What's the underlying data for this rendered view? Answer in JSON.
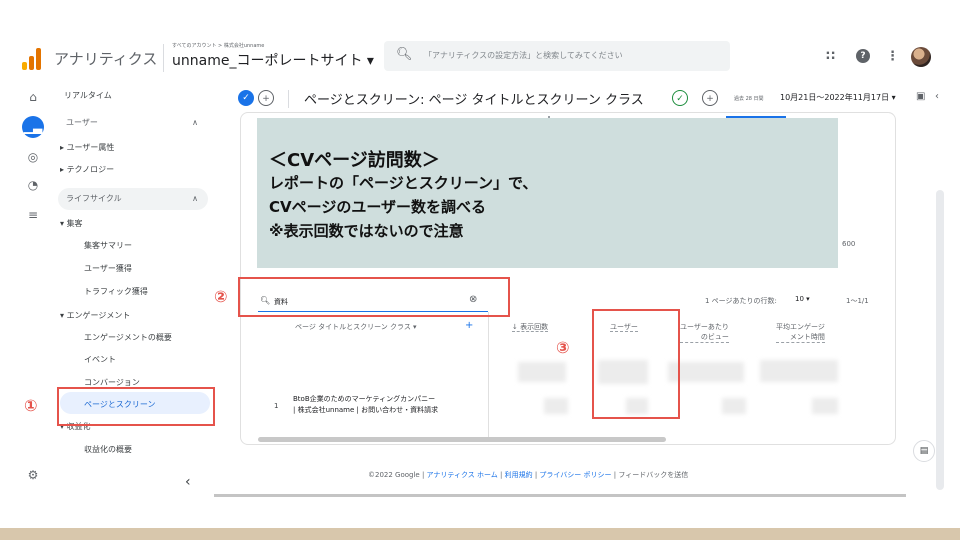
{
  "header": {
    "app_title": "アナリティクス",
    "account_path": "すべてのアカウント > 株式会社unname",
    "property_name": "unname_コーポレートサイト ▾",
    "search_placeholder": "「アナリティクスの設定方法」と検索してみてください"
  },
  "sidebar": {
    "realtime": "リアルタイム",
    "users_section": "ユーザー",
    "user_attributes": "ユーザー属性",
    "technology": "テクノロジー",
    "lifecycle_section": "ライフサイクル",
    "acquisition": "集客",
    "acquisition_summary": "集客サマリー",
    "user_acquisition": "ユーザー獲得",
    "traffic_acquisition": "トラフィック獲得",
    "engagement": "エンゲージメント",
    "engagement_overview": "エンゲージメントの概要",
    "events": "イベント",
    "conversions": "コンバージョン",
    "pages_and_screens": "ページとスクリーン",
    "monetization": "収益化",
    "monetization_overview": "収益化の概要"
  },
  "report": {
    "title": "ページとスクリーン: ページ タイトルとスクリーン クラス",
    "date_small": "過去 28 日間",
    "date_range": "10月21日～2022年11月17日 ▾",
    "axis_tick": "600"
  },
  "note": {
    "line1": "＜CVページ訪問数＞",
    "line2": "レポートの「ページとスクリーン」で、",
    "line3": "CVページのユーザー数を調べる",
    "line4": "※表示回数ではないので注意"
  },
  "table": {
    "search_value": "資料",
    "rows_per_page_label": "1 ページあたりの行数:",
    "rows_per_page_value": "10 ▾",
    "range": "1～1/1",
    "dimension_header": "ページ タイトルとスクリーン クラス ▾",
    "col_views": "↓ 表示回数",
    "col_users": "ユーザー",
    "col_views_per_user_1": "ユーザーあたり",
    "col_views_per_user_2": "のビュー",
    "col_avg_engagement_1": "平均エンゲージ",
    "col_avg_engagement_2": "メント時間",
    "row_number": "1",
    "row_title_1": "BtoB企業のためのマーケティングカンパニー",
    "row_title_2": "| 株式会社unname | お問い合わせ・資料請求"
  },
  "footer": {
    "copyright": "©2022 Google | ",
    "link_home": "アナリティクス ホーム",
    "sep1": " | ",
    "link_terms": "利用規約",
    "sep2": " | ",
    "link_privacy": "プライバシー ポリシー",
    "sep3": " | ",
    "feedback": "フィードバックを送信"
  },
  "callouts": {
    "n1": "①",
    "n2": "②",
    "n3": "③"
  },
  "colors": {
    "accent": "#1a73e8",
    "callout": "#e5534b",
    "note_bg": "#cfdedd"
  }
}
